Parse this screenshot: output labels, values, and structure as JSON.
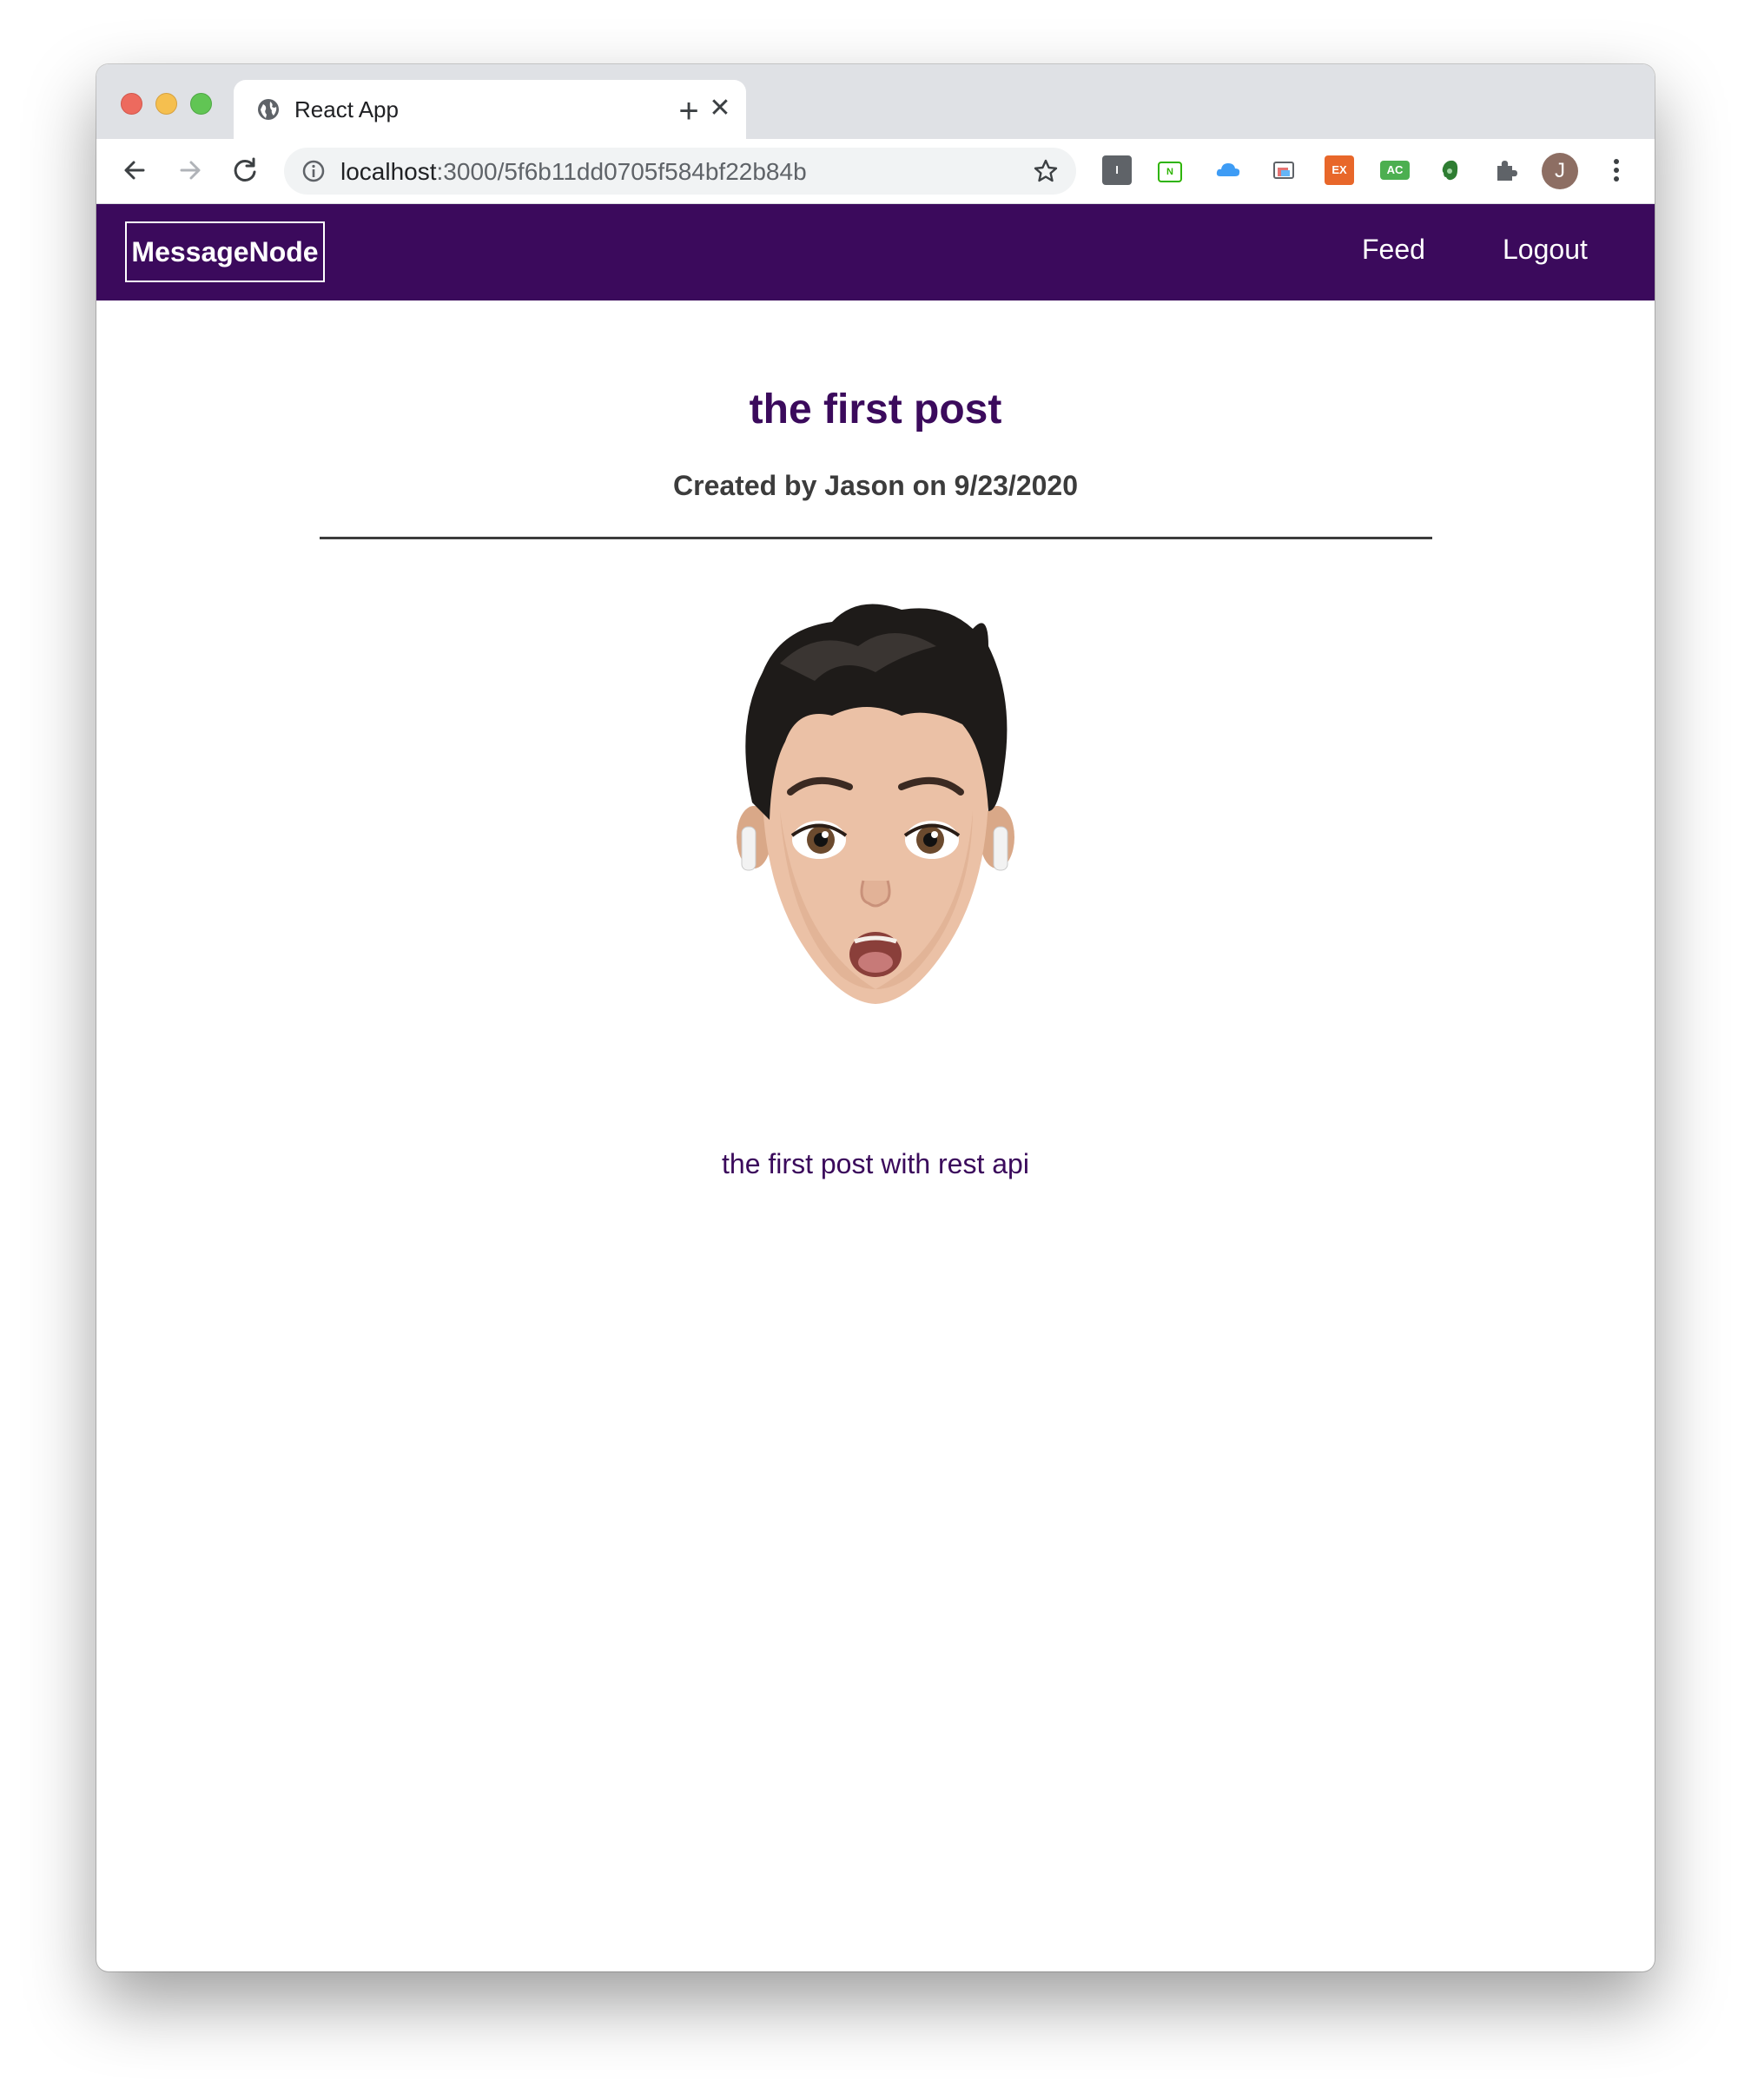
{
  "browser": {
    "tab_title": "React App",
    "url_host": "localhost",
    "url_path": ":3000/5f6b11dd0705f584bf22b84b",
    "avatar_letter": "J",
    "extensions": [
      {
        "name": "instapaper-extension-icon",
        "label": "I",
        "color": "#5f6368"
      },
      {
        "name": "naver-extension-icon",
        "label": "N",
        "color": "#2db400"
      },
      {
        "name": "cloud-extension-icon",
        "label": "",
        "color": "#1a73e8"
      },
      {
        "name": "screenshot-extension-icon",
        "label": "",
        "color": "#5f6368"
      },
      {
        "name": "ex-extension-icon",
        "label": "EX",
        "color": "#e8672a"
      },
      {
        "name": "ac-extension-icon",
        "label": "AC",
        "color": "#4caf50"
      },
      {
        "name": "evernote-extension-icon",
        "label": "",
        "color": "#2e7d32"
      },
      {
        "name": "puzzle-extension-icon",
        "label": "",
        "color": "#5f6368"
      }
    ]
  },
  "header": {
    "logo": "MessageNode",
    "nav": [
      "Feed",
      "Logout"
    ],
    "bg_color": "#3b0a5c"
  },
  "post": {
    "title": "the first post",
    "meta": "Created by Jason on 9/23/2020",
    "content": "the first post with rest api",
    "image_alt": "memoji-avatar"
  }
}
